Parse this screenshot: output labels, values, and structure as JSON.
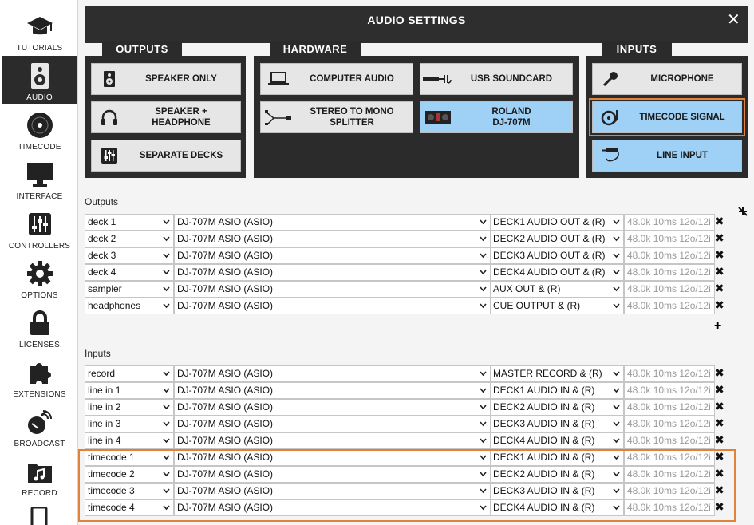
{
  "sidebar": {
    "items": [
      {
        "label": "TUTORIALS"
      },
      {
        "label": "AUDIO"
      },
      {
        "label": "TIMECODE"
      },
      {
        "label": "INTERFACE"
      },
      {
        "label": "CONTROLLERS"
      },
      {
        "label": "OPTIONS"
      },
      {
        "label": "LICENSES"
      },
      {
        "label": "EXTENSIONS"
      },
      {
        "label": "BROADCAST"
      },
      {
        "label": "RECORD"
      }
    ]
  },
  "window": {
    "title": "AUDIO SETTINGS",
    "close_glyph": "✕"
  },
  "groups": {
    "outputs": {
      "title": "OUTPUTS",
      "buttons": [
        {
          "label": "SPEAKER ONLY"
        },
        {
          "label": "SPEAKER +\nHEADPHONE"
        },
        {
          "label": "SEPARATE DECKS"
        }
      ]
    },
    "hardware": {
      "title": "HARDWARE",
      "buttons": [
        {
          "label": "COMPUTER AUDIO"
        },
        {
          "label": "USB SOUNDCARD"
        },
        {
          "label": "STEREO TO MONO\nSPLITTER"
        },
        {
          "label": "ROLAND\nDJ-707M"
        }
      ]
    },
    "inputs": {
      "title": "INPUTS",
      "buttons": [
        {
          "label": "MICROPHONE"
        },
        {
          "label": "TIMECODE SIGNAL"
        },
        {
          "label": "LINE INPUT"
        }
      ]
    }
  },
  "outputs_section": {
    "label": "Outputs",
    "rows": [
      {
        "channel": "deck 1",
        "device": "DJ-707M ASIO (ASIO)",
        "port": "DECK1 AUDIO OUT & (R)",
        "info": "48.0k 10ms 12o/12i"
      },
      {
        "channel": "deck 2",
        "device": "DJ-707M ASIO (ASIO)",
        "port": "DECK2 AUDIO OUT & (R)",
        "info": "48.0k 10ms 12o/12i"
      },
      {
        "channel": "deck 3",
        "device": "DJ-707M ASIO (ASIO)",
        "port": "DECK3 AUDIO OUT & (R)",
        "info": "48.0k 10ms 12o/12i"
      },
      {
        "channel": "deck 4",
        "device": "DJ-707M ASIO (ASIO)",
        "port": "DECK4 AUDIO OUT & (R)",
        "info": "48.0k 10ms 12o/12i"
      },
      {
        "channel": "sampler",
        "device": "DJ-707M ASIO (ASIO)",
        "port": "AUX OUT & (R)",
        "info": "48.0k 10ms 12o/12i"
      },
      {
        "channel": "headphones",
        "device": "DJ-707M ASIO (ASIO)",
        "port": "CUE OUTPUT & (R)",
        "info": "48.0k 10ms 12o/12i"
      }
    ],
    "add_glyph": "+"
  },
  "inputs_section": {
    "label": "Inputs",
    "rows": [
      {
        "channel": "record",
        "device": "DJ-707M ASIO (ASIO)",
        "port": "MASTER RECORD & (R)",
        "info": "48.0k 10ms 12o/12i"
      },
      {
        "channel": "line in 1",
        "device": "DJ-707M ASIO (ASIO)",
        "port": "DECK1 AUDIO IN & (R)",
        "info": "48.0k 10ms 12o/12i"
      },
      {
        "channel": "line in 2",
        "device": "DJ-707M ASIO (ASIO)",
        "port": "DECK2 AUDIO IN & (R)",
        "info": "48.0k 10ms 12o/12i"
      },
      {
        "channel": "line in 3",
        "device": "DJ-707M ASIO (ASIO)",
        "port": "DECK3 AUDIO IN & (R)",
        "info": "48.0k 10ms 12o/12i"
      },
      {
        "channel": "line in 4",
        "device": "DJ-707M ASIO (ASIO)",
        "port": "DECK4 AUDIO IN & (R)",
        "info": "48.0k 10ms 12o/12i"
      },
      {
        "channel": "timecode 1",
        "device": "DJ-707M ASIO (ASIO)",
        "port": "DECK1 AUDIO IN & (R)",
        "info": "48.0k 10ms 12o/12i"
      },
      {
        "channel": "timecode 2",
        "device": "DJ-707M ASIO (ASIO)",
        "port": "DECK2 AUDIO IN & (R)",
        "info": "48.0k 10ms 12o/12i"
      },
      {
        "channel": "timecode 3",
        "device": "DJ-707M ASIO (ASIO)",
        "port": "DECK3 AUDIO IN & (R)",
        "info": "48.0k 10ms 12o/12i"
      },
      {
        "channel": "timecode 4",
        "device": "DJ-707M ASIO (ASIO)",
        "port": "DECK4 AUDIO IN & (R)",
        "info": "48.0k 10ms 12o/12i"
      }
    ]
  },
  "glyphs": {
    "chevron": "⌄",
    "remove": "✖"
  },
  "colors": {
    "selected": "#9fd0f6",
    "highlight": "#e0823a",
    "panel_dark": "#2b2b2b"
  }
}
